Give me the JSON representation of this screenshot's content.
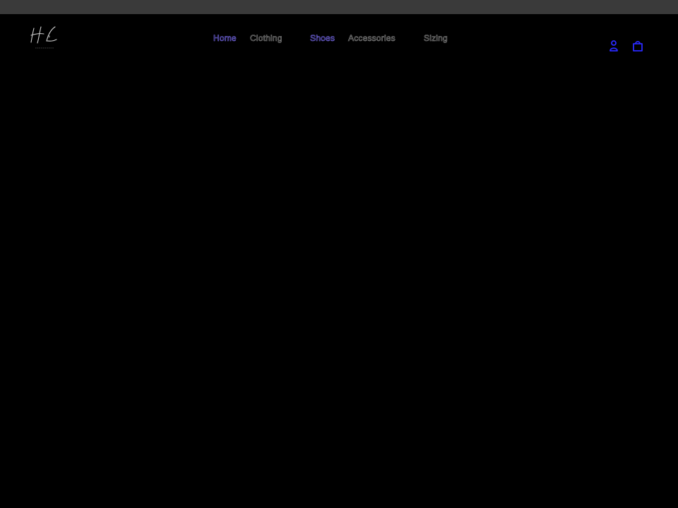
{
  "nav": {
    "items": [
      {
        "label": "Home",
        "active": true
      },
      {
        "label": "Clothing",
        "active": false
      },
      {
        "label": "Shoes",
        "active": true
      },
      {
        "label": "Accessories",
        "active": false
      },
      {
        "label": "Sizing",
        "active": false
      }
    ]
  },
  "icons": {
    "account": "account-icon",
    "cart": "cart-icon"
  },
  "colors": {
    "background": "#000000",
    "topbar": "#3a3a3a",
    "nav_text": "#8a8a8a",
    "nav_active": "#7a6cf0",
    "icon_accent": "#2a2aff"
  }
}
